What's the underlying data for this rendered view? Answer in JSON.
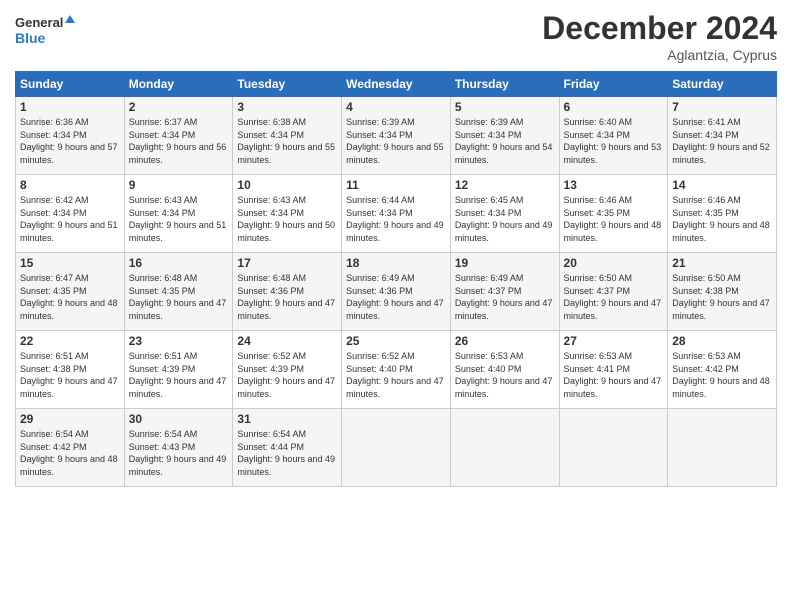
{
  "header": {
    "logo_general": "General",
    "logo_blue": "Blue",
    "month_title": "December 2024",
    "location": "Aglantzia, Cyprus"
  },
  "weekdays": [
    "Sunday",
    "Monday",
    "Tuesday",
    "Wednesday",
    "Thursday",
    "Friday",
    "Saturday"
  ],
  "weeks": [
    [
      {
        "day": "1",
        "sunrise": "6:36 AM",
        "sunset": "4:34 PM",
        "daylight": "9 hours and 57 minutes."
      },
      {
        "day": "2",
        "sunrise": "6:37 AM",
        "sunset": "4:34 PM",
        "daylight": "9 hours and 56 minutes."
      },
      {
        "day": "3",
        "sunrise": "6:38 AM",
        "sunset": "4:34 PM",
        "daylight": "9 hours and 55 minutes."
      },
      {
        "day": "4",
        "sunrise": "6:39 AM",
        "sunset": "4:34 PM",
        "daylight": "9 hours and 55 minutes."
      },
      {
        "day": "5",
        "sunrise": "6:39 AM",
        "sunset": "4:34 PM",
        "daylight": "9 hours and 54 minutes."
      },
      {
        "day": "6",
        "sunrise": "6:40 AM",
        "sunset": "4:34 PM",
        "daylight": "9 hours and 53 minutes."
      },
      {
        "day": "7",
        "sunrise": "6:41 AM",
        "sunset": "4:34 PM",
        "daylight": "9 hours and 52 minutes."
      }
    ],
    [
      {
        "day": "8",
        "sunrise": "6:42 AM",
        "sunset": "4:34 PM",
        "daylight": "9 hours and 51 minutes."
      },
      {
        "day": "9",
        "sunrise": "6:43 AM",
        "sunset": "4:34 PM",
        "daylight": "9 hours and 51 minutes."
      },
      {
        "day": "10",
        "sunrise": "6:43 AM",
        "sunset": "4:34 PM",
        "daylight": "9 hours and 50 minutes."
      },
      {
        "day": "11",
        "sunrise": "6:44 AM",
        "sunset": "4:34 PM",
        "daylight": "9 hours and 49 minutes."
      },
      {
        "day": "12",
        "sunrise": "6:45 AM",
        "sunset": "4:34 PM",
        "daylight": "9 hours and 49 minutes."
      },
      {
        "day": "13",
        "sunrise": "6:46 AM",
        "sunset": "4:35 PM",
        "daylight": "9 hours and 48 minutes."
      },
      {
        "day": "14",
        "sunrise": "6:46 AM",
        "sunset": "4:35 PM",
        "daylight": "9 hours and 48 minutes."
      }
    ],
    [
      {
        "day": "15",
        "sunrise": "6:47 AM",
        "sunset": "4:35 PM",
        "daylight": "9 hours and 48 minutes."
      },
      {
        "day": "16",
        "sunrise": "6:48 AM",
        "sunset": "4:35 PM",
        "daylight": "9 hours and 47 minutes."
      },
      {
        "day": "17",
        "sunrise": "6:48 AM",
        "sunset": "4:36 PM",
        "daylight": "9 hours and 47 minutes."
      },
      {
        "day": "18",
        "sunrise": "6:49 AM",
        "sunset": "4:36 PM",
        "daylight": "9 hours and 47 minutes."
      },
      {
        "day": "19",
        "sunrise": "6:49 AM",
        "sunset": "4:37 PM",
        "daylight": "9 hours and 47 minutes."
      },
      {
        "day": "20",
        "sunrise": "6:50 AM",
        "sunset": "4:37 PM",
        "daylight": "9 hours and 47 minutes."
      },
      {
        "day": "21",
        "sunrise": "6:50 AM",
        "sunset": "4:38 PM",
        "daylight": "9 hours and 47 minutes."
      }
    ],
    [
      {
        "day": "22",
        "sunrise": "6:51 AM",
        "sunset": "4:38 PM",
        "daylight": "9 hours and 47 minutes."
      },
      {
        "day": "23",
        "sunrise": "6:51 AM",
        "sunset": "4:39 PM",
        "daylight": "9 hours and 47 minutes."
      },
      {
        "day": "24",
        "sunrise": "6:52 AM",
        "sunset": "4:39 PM",
        "daylight": "9 hours and 47 minutes."
      },
      {
        "day": "25",
        "sunrise": "6:52 AM",
        "sunset": "4:40 PM",
        "daylight": "9 hours and 47 minutes."
      },
      {
        "day": "26",
        "sunrise": "6:53 AM",
        "sunset": "4:40 PM",
        "daylight": "9 hours and 47 minutes."
      },
      {
        "day": "27",
        "sunrise": "6:53 AM",
        "sunset": "4:41 PM",
        "daylight": "9 hours and 47 minutes."
      },
      {
        "day": "28",
        "sunrise": "6:53 AM",
        "sunset": "4:42 PM",
        "daylight": "9 hours and 48 minutes."
      }
    ],
    [
      {
        "day": "29",
        "sunrise": "6:54 AM",
        "sunset": "4:42 PM",
        "daylight": "9 hours and 48 minutes."
      },
      {
        "day": "30",
        "sunrise": "6:54 AM",
        "sunset": "4:43 PM",
        "daylight": "9 hours and 49 minutes."
      },
      {
        "day": "31",
        "sunrise": "6:54 AM",
        "sunset": "4:44 PM",
        "daylight": "9 hours and 49 minutes."
      },
      null,
      null,
      null,
      null
    ]
  ]
}
